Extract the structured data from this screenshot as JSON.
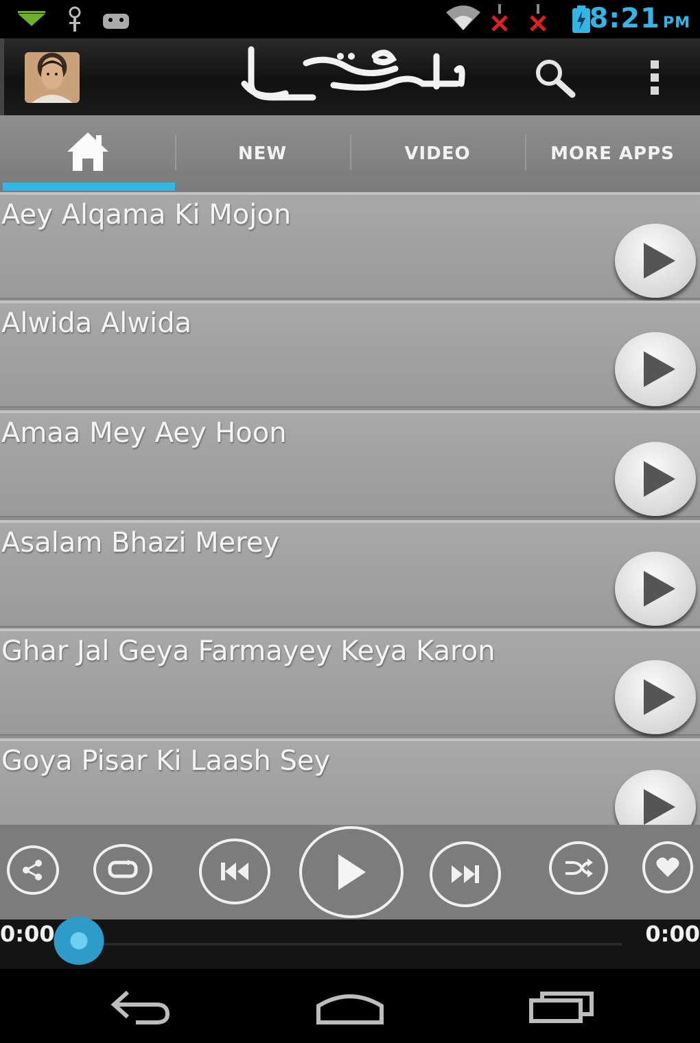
{
  "status_bar": {
    "time": "8:21",
    "ampm": "PM",
    "icons": [
      "download-arrow-icon",
      "usb-icon",
      "android-debug-icon",
      "wifi-icon",
      "signal-blocked-icon",
      "signal-blocked-icon",
      "battery-charging-icon"
    ]
  },
  "action_bar": {
    "avatar": "avatar-icon",
    "logo": "syed-farhan-ali-urdu-logo",
    "search_icon": "search-icon",
    "menu_icon": "overflow-menu-icon"
  },
  "tabs": [
    {
      "label": "",
      "icon": "home-icon",
      "active": true
    },
    {
      "label": "NEW",
      "active": false
    },
    {
      "label": "VIDEO",
      "active": false
    },
    {
      "label": "MORE APPS",
      "active": false
    }
  ],
  "tracks": [
    {
      "title": "Aey Alqama Ki Mojon"
    },
    {
      "title": "Alwida Alwida"
    },
    {
      "title": "Amaa Mey Aey Hoon"
    },
    {
      "title": "Asalam Bhazi Merey"
    },
    {
      "title": "Ghar Jal Geya Farmayey Keya Karon"
    },
    {
      "title": "Goya Pisar Ki Laash Sey"
    }
  ],
  "player": {
    "buttons": [
      "share-icon",
      "repeat-icon",
      "previous-icon",
      "play-icon",
      "next-icon",
      "shuffle-icon",
      "favorite-heart-icon"
    ],
    "elapsed": "0:00",
    "duration": "0:00",
    "progress_fraction": 0.0
  },
  "colors": {
    "accent": "#33b5e5",
    "list_bg": "#a4a4a4",
    "tab_bg": "#848484"
  },
  "nav_bar": [
    "back-icon",
    "home-nav-icon",
    "recent-apps-icon"
  ]
}
